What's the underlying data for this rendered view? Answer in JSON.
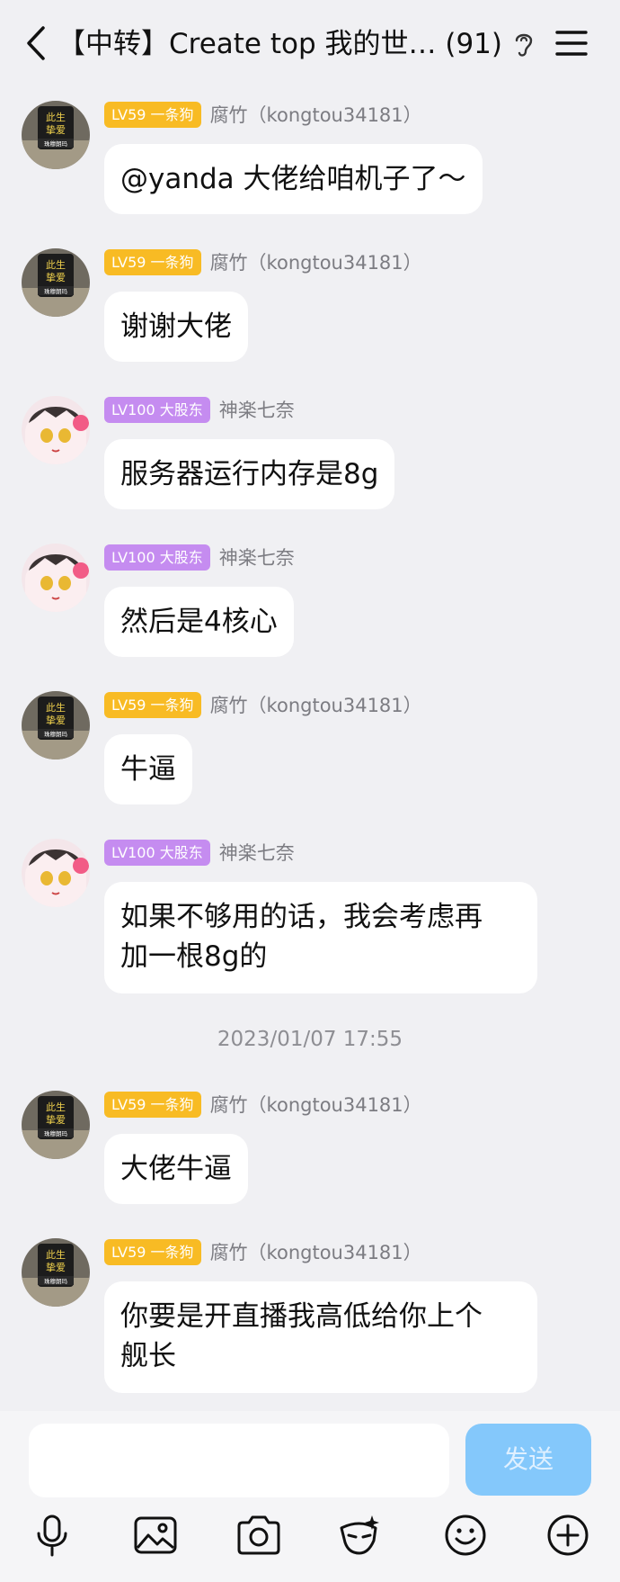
{
  "header": {
    "title": "【中转】Create top 我的世… (91)"
  },
  "messages": [
    {
      "badge": "LV59 一条狗",
      "badge_color": "#f8bb24",
      "name": "腐竹（kongtou34181）",
      "lines": [
        "@yanda 大佬给咱机子了～"
      ]
    },
    {
      "badge": "LV59 一条狗",
      "badge_color": "#f8bb24",
      "name": "腐竹（kongtou34181）",
      "lines": [
        "谢谢大佬"
      ]
    },
    {
      "badge": "LV100 大股东",
      "badge_color": "#c58cf0",
      "name": "神楽七奈",
      "lines": [
        "服务器运行内存是8g"
      ]
    },
    {
      "badge": "LV100 大股东",
      "badge_color": "#c58cf0",
      "name": "神楽七奈",
      "lines": [
        "然后是4核心"
      ]
    },
    {
      "badge": "LV59 一条狗",
      "badge_color": "#f8bb24",
      "name": "腐竹（kongtou34181）",
      "lines": [
        "牛逼"
      ]
    },
    {
      "badge": "LV100 大股东",
      "badge_color": "#c58cf0",
      "name": "神楽七奈",
      "lines": [
        "如果不够用的话，我会考虑再",
        "加一根8g的"
      ]
    },
    {
      "badge": "LV59 一条狗",
      "badge_color": "#f8bb24",
      "name": "腐竹（kongtou34181）",
      "lines": [
        "大佬牛逼"
      ]
    },
    {
      "badge": "LV59 一条狗",
      "badge_color": "#f8bb24",
      "name": "腐竹（kongtou34181）",
      "lines": [
        "你要是开直播我高低给你上个",
        "舰长"
      ]
    }
  ],
  "timestamp": "2023/01/07 17:55",
  "avatar_labels": {
    "top": "此生",
    "mid": "挚爱",
    "bottom": "珠穆朗玛"
  },
  "input": {
    "send_label": "发送",
    "send_color": "#84c8fb"
  },
  "toolbar": [
    "microphone-icon",
    "image-icon",
    "camera-icon",
    "mask-icon",
    "emoji-icon",
    "plus-icon"
  ]
}
